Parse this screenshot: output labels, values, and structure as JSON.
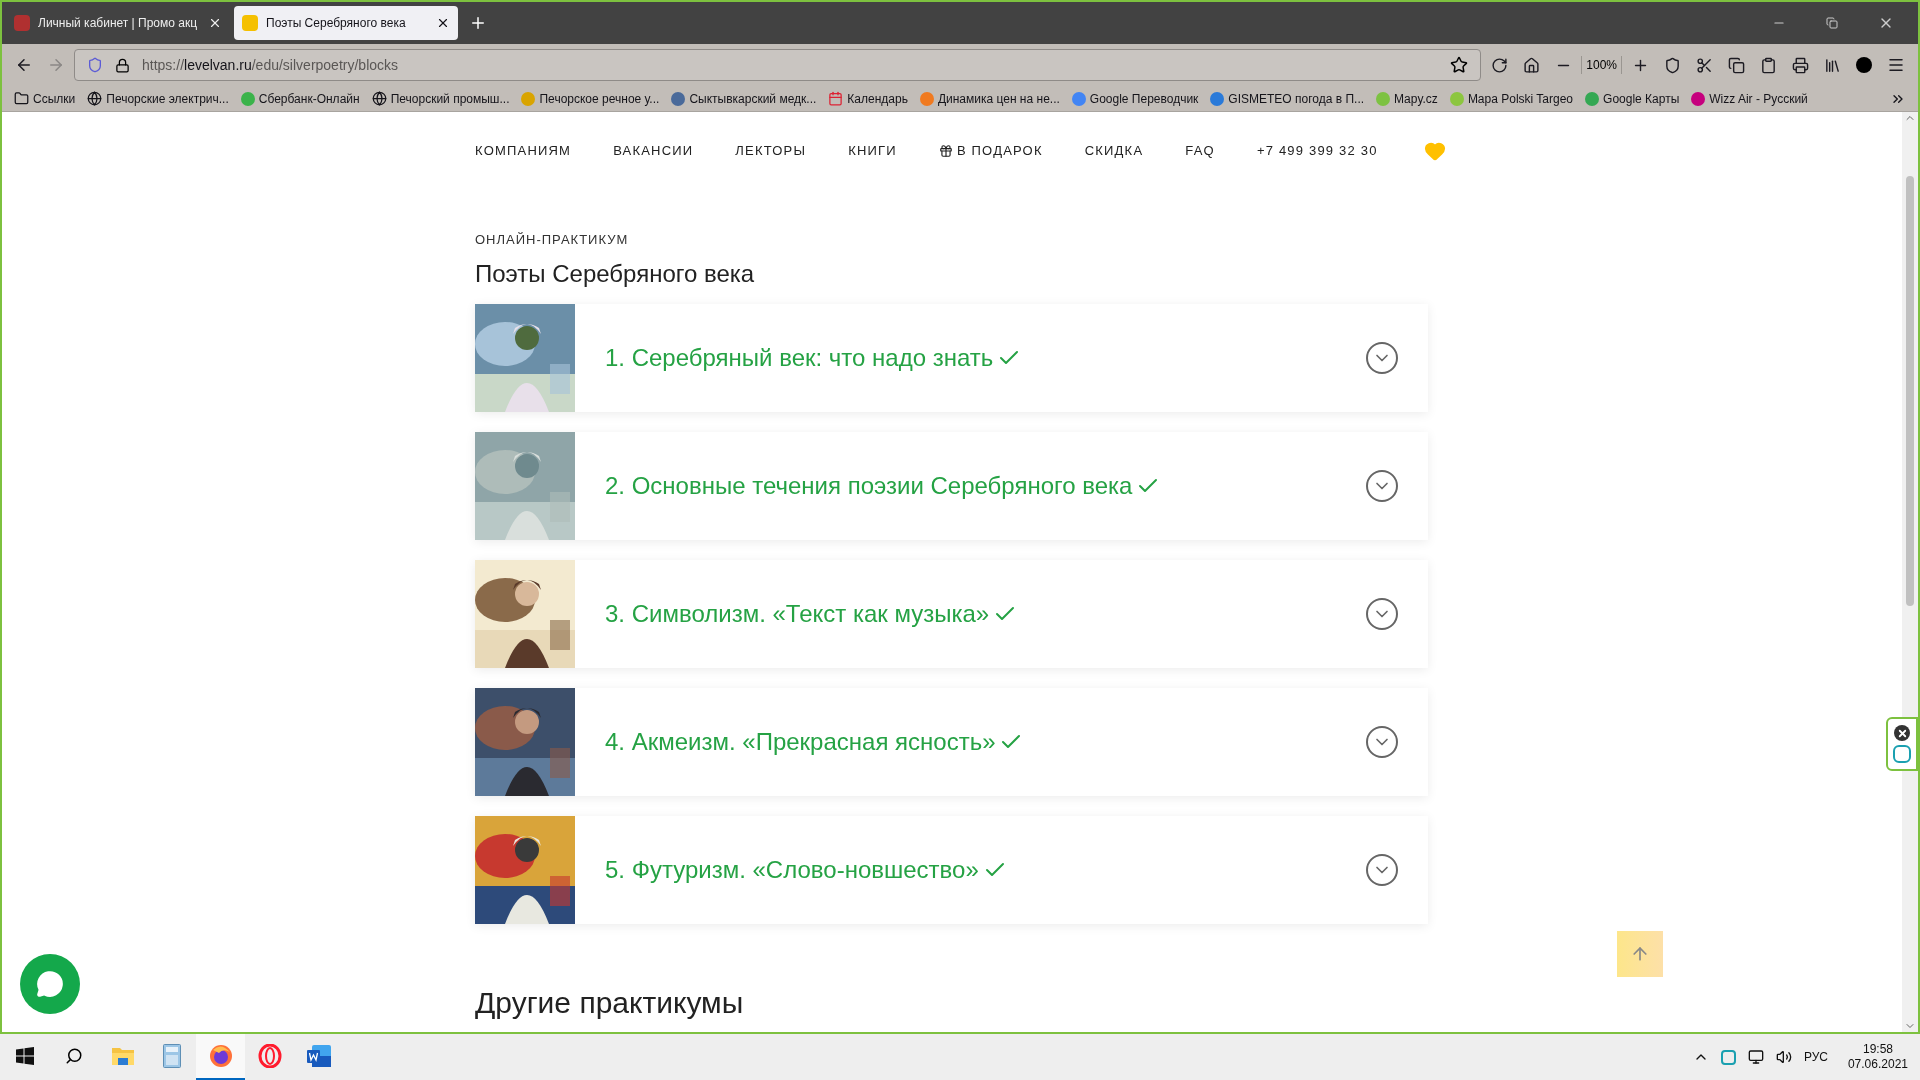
{
  "tabs": [
    {
      "title": "Личный кабинет | Промо акц",
      "selected": false
    },
    {
      "title": "Поэты Серебряного века",
      "selected": true
    }
  ],
  "address": {
    "host": "levelvan.ru",
    "path": "/edu/silverpoetry/blocks",
    "scheme": "https://"
  },
  "zoom": "100%",
  "bookmarks": [
    "Ссылки",
    "Печорские электрич...",
    "Сбербанк-Онлайн",
    "Печорский промыш...",
    "Печорское речное у...",
    "Сыктывкарский медк...",
    "Календарь",
    "Динамика цен на не...",
    "Google Переводчик",
    "GISMETEO погода в П...",
    "Mapy.cz",
    "Mapa Polski Targeo",
    "Google Карты",
    "Wizz Air - Русский"
  ],
  "nav": [
    {
      "label": "КОМПАНИЯМ",
      "kind": "text"
    },
    {
      "label": "ВАКАНСИИ",
      "kind": "text"
    },
    {
      "label": "ЛЕКТОРЫ",
      "kind": "text"
    },
    {
      "label": "КНИГИ",
      "kind": "text"
    },
    {
      "label": "В ПОДАРОК",
      "kind": "gift"
    },
    {
      "label": "СКИДКА",
      "kind": "text"
    },
    {
      "label": "FAQ",
      "kind": "text"
    },
    {
      "label": "+7 499 399 32 30",
      "kind": "text"
    }
  ],
  "eyebrow": "ОНЛАЙН-ПРАКТИКУМ",
  "heading": "Поэты Серебряного века",
  "blocks": [
    {
      "title": "1. Серебряный век: что надо знать",
      "completed": true,
      "expanded": false
    },
    {
      "title": "2. Основные течения поэзии Серебряного века",
      "completed": true,
      "expanded": false
    },
    {
      "title": "3. Символизм. «Текст как музыка»",
      "completed": true,
      "expanded": false
    },
    {
      "title": "4. Акмеизм. «Прекрасная ясность»",
      "completed": true,
      "expanded": false
    },
    {
      "title": "5. Футуризм. «Слово-новшество»",
      "completed": true,
      "expanded": false
    }
  ],
  "more_heading": "Другие практикумы",
  "taskbar": [
    {
      "kind": "start",
      "active": false
    },
    {
      "kind": "search",
      "active": false
    },
    {
      "kind": "explorer",
      "active": false
    },
    {
      "kind": "calculator",
      "active": false
    },
    {
      "kind": "firefox",
      "active": true
    },
    {
      "kind": "opera",
      "active": false
    },
    {
      "kind": "word",
      "active": false
    }
  ],
  "tray": {
    "language": "РУС",
    "time": "19:58",
    "date": "07.06.2021"
  }
}
